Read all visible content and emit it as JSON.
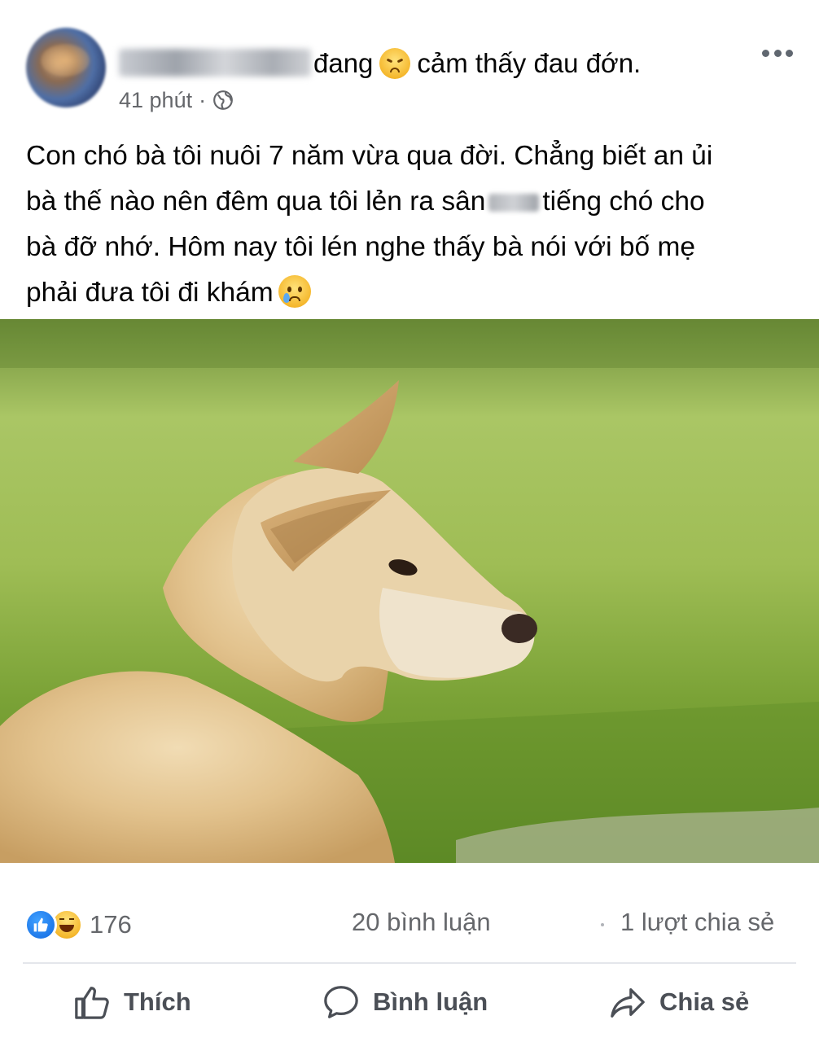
{
  "post": {
    "headline_verb": "đang",
    "feeling_text": "cảm thấy đau đớn.",
    "timestamp": "41 phút",
    "separator": "·",
    "body_lines": [
      "Con chó bà tôi nuôi 7 năm vừa qua đời. Chẳng biết an ủi",
      "bà thế nào nên đêm qua tôi lẻn ra sân",
      "tiếng chó cho",
      "bà đỡ nhớ. Hôm nay tôi lén nghe thấy bà nói với bố mẹ",
      "phải đưa tôi đi khám"
    ]
  },
  "stats": {
    "reaction_count": "176",
    "comments": "20 bình luận",
    "shares": "1 lượt chia sẻ"
  },
  "actions": {
    "like": "Thích",
    "comment": "Bình luận",
    "share": "Chia sẻ"
  },
  "icons": {
    "more": "more-options-icon",
    "audience": "globe-icon",
    "like": "thumbs-up-icon",
    "comment": "speech-bubble-icon",
    "share": "share-arrow-icon"
  },
  "colors": {
    "text": "#050505",
    "secondary": "#65676b",
    "action": "#4b4f56",
    "like_blue": "#1168e0",
    "divider": "#e4e6eb"
  }
}
